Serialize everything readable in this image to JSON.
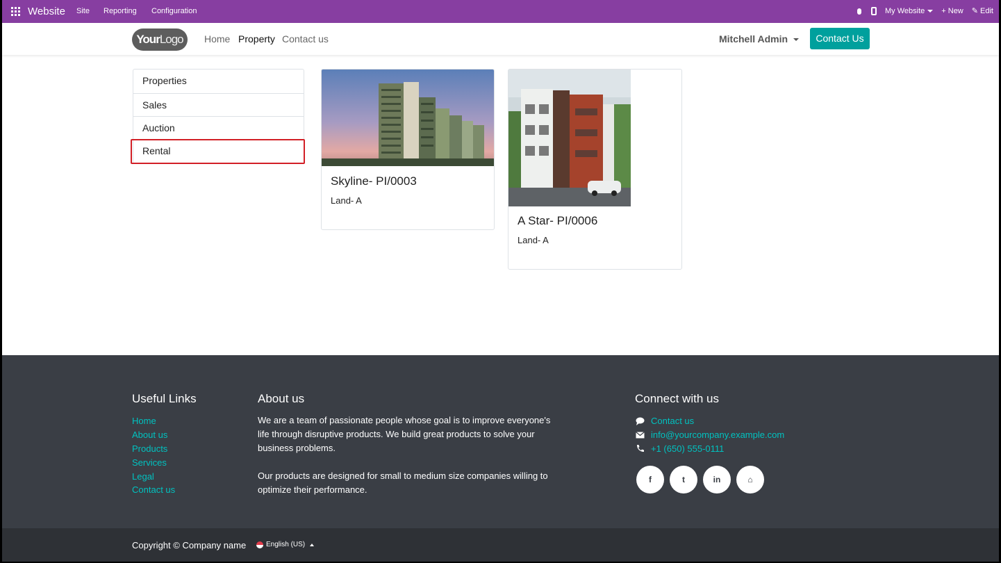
{
  "adminbar": {
    "brand": "Website",
    "menu": [
      "Site",
      "Reporting",
      "Configuration"
    ],
    "my_website": "My Website",
    "new_label": "+ New",
    "edit_label": "✎ Edit"
  },
  "header": {
    "logo_bold": "Your",
    "logo_light": "Logo",
    "nav": [
      "Home",
      "Property",
      "Contact us"
    ],
    "user": "Mitchell Admin",
    "contact_button": "Contact Us"
  },
  "sidebar": {
    "items": [
      {
        "label": "Properties"
      },
      {
        "label": "Sales"
      },
      {
        "label": "Auction"
      },
      {
        "label": "Rental"
      }
    ]
  },
  "cards": [
    {
      "title": "Skyline- PI/0003",
      "subtitle": "Land- A"
    },
    {
      "title": "A Star- PI/0006",
      "subtitle": "Land- A"
    }
  ],
  "footer": {
    "useful_links_title": "Useful Links",
    "useful_links": [
      "Home",
      "About us",
      "Products",
      "Services",
      "Legal",
      "Contact us"
    ],
    "about_title": "About us",
    "about_p1_l1": "We are a team of passionate people whose goal is to improve everyone's",
    "about_p1_l2": "life through disruptive products. We build great products to solve your",
    "about_p1_l3": "business problems.",
    "about_p2_l1": "Our products are designed for small to medium size companies willing to",
    "about_p2_l2": "optimize their performance.",
    "connect_title": "Connect with us",
    "contact_link": "Contact us",
    "email": "info@yourcompany.example.com",
    "phone": "+1 (650) 555-0111",
    "social": [
      "f",
      "t",
      "in",
      "⌂"
    ],
    "copyright": "Copyright © Company name",
    "language": "English (US)"
  },
  "colors": {
    "admin_bar": "#873ea1",
    "accent": "#00a09d",
    "footer_bg": "#3a3e45",
    "selected_border": "#d21f26"
  }
}
